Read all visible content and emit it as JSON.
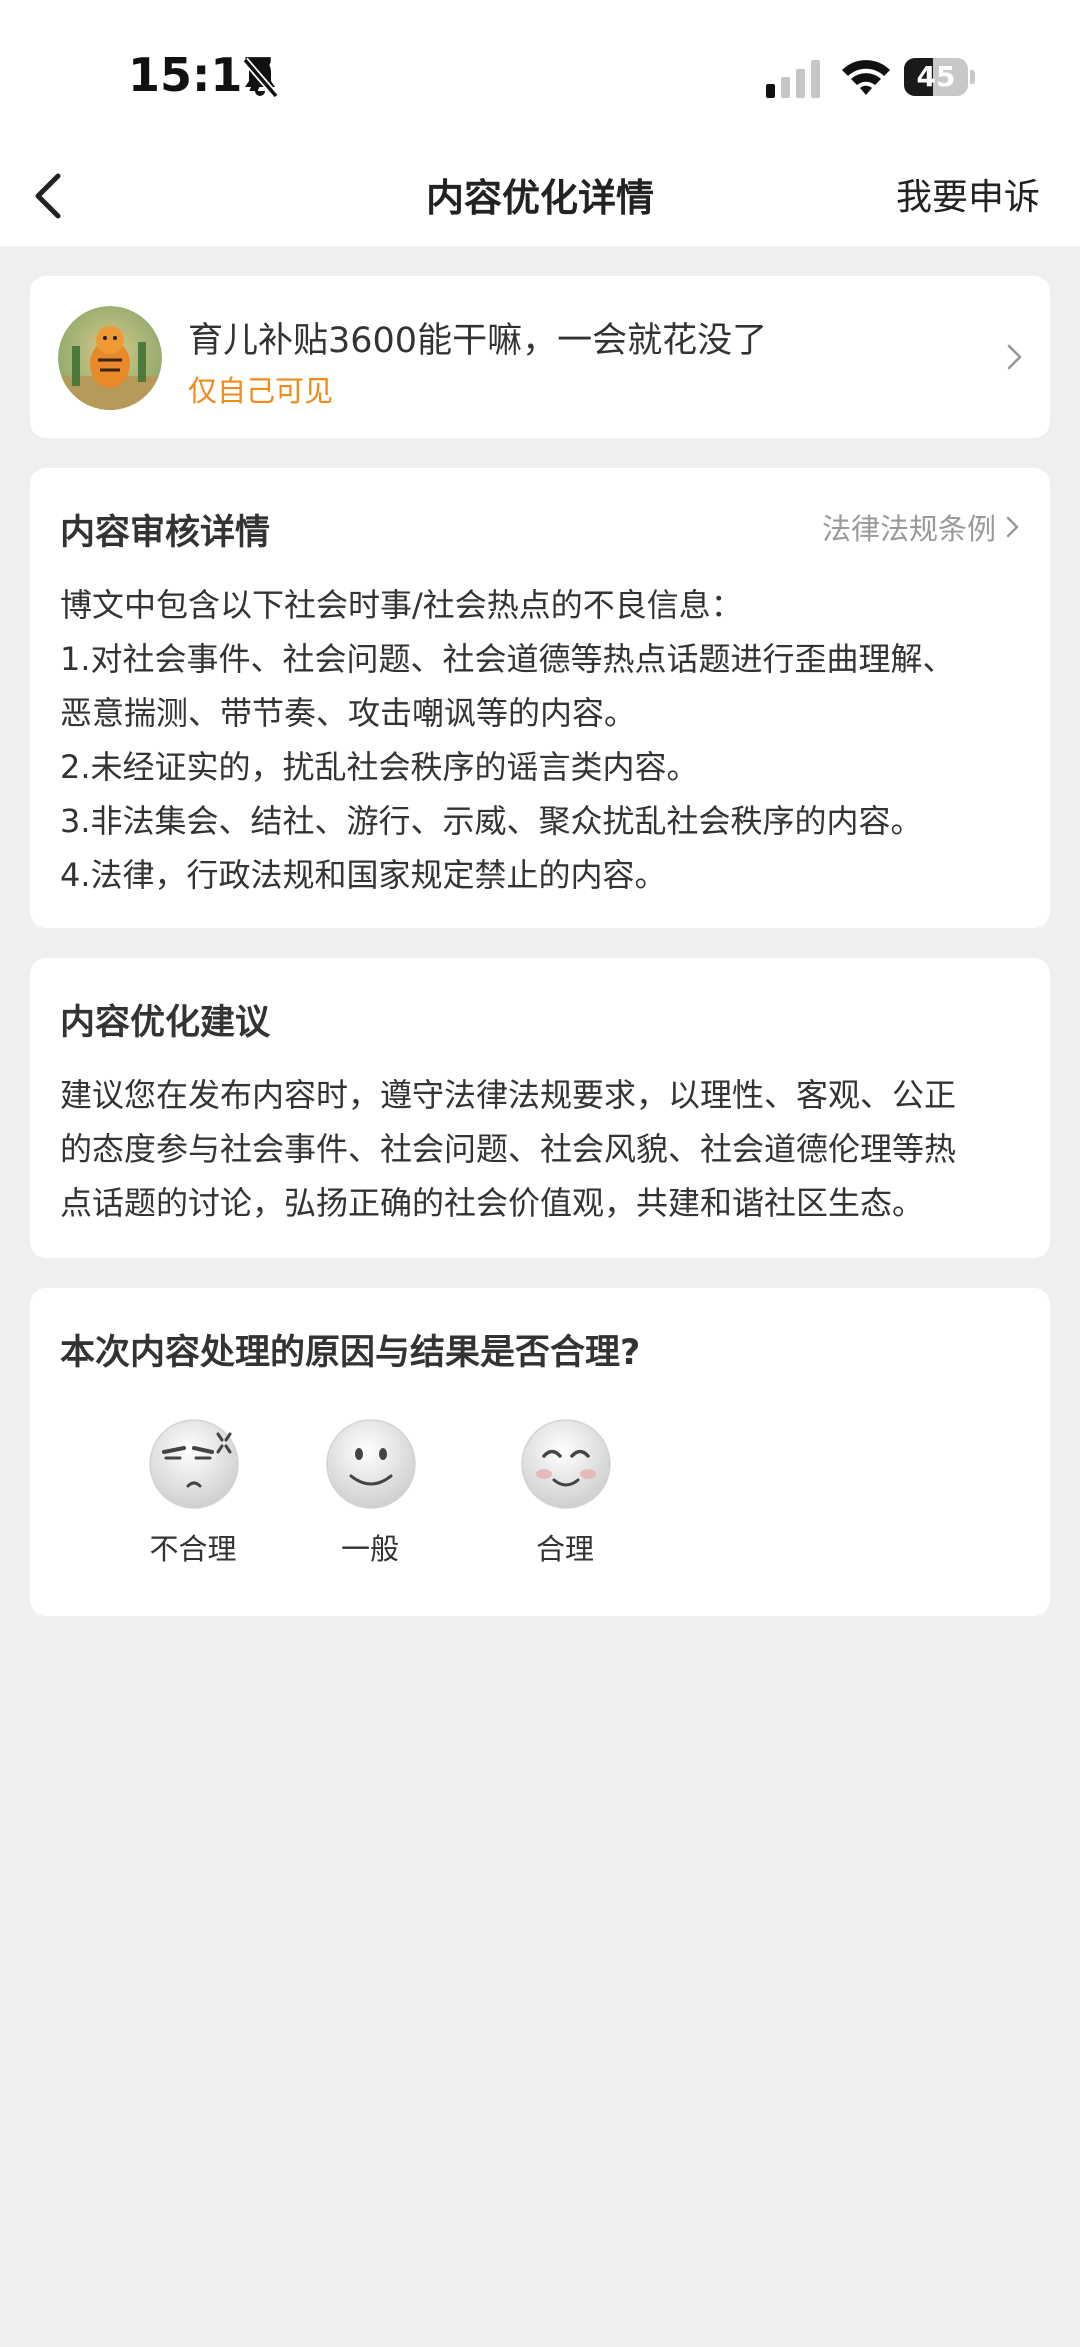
{
  "status_bar": {
    "time": "15:17",
    "battery_level": "45",
    "battery_fraction": 0.45,
    "icons": [
      "bell-slash-icon",
      "cellular-signal-icon",
      "wifi-icon",
      "battery-icon"
    ]
  },
  "nav": {
    "back_icon": "chevron-left-icon",
    "title": "内容优化详情",
    "appeal_label": "我要申诉"
  },
  "post": {
    "title": "育儿补贴3600能干嘛，一会就花没了",
    "visibility": "仅自己可见",
    "visibility_color": "#f08b19"
  },
  "review": {
    "title": "内容审核详情",
    "law_link": "法律法规条例",
    "lines": [
      "博文中包含以下社会时事/社会热点的不良信息：",
      "1.对社会事件、社会问题、社会道德等热点话题进行歪曲理解、",
      "恶意揣测、带节奏、攻击嘲讽等的内容。",
      "2.未经证实的，扰乱社会秩序的谣言类内容。",
      "3.非法集会、结社、游行、示威、聚众扰乱社会秩序的内容。",
      "4.法律，行政法规和国家规定禁止的内容。"
    ]
  },
  "suggestion": {
    "title": "内容优化建议",
    "lines": [
      "建议您在发布内容时，遵守法律法规要求，以理性、客观、公正",
      "的态度参与社会事件、社会问题、社会风貌、社会道德伦理等热",
      "点话题的讨论，弘扬正确的社会价值观，共建和谐社区生态。"
    ]
  },
  "rating": {
    "question": "本次内容处理的原因与结果是否合理?",
    "options": [
      {
        "label": "不合理",
        "icon": "angry-face-icon"
      },
      {
        "label": "一般",
        "icon": "neutral-face-icon"
      },
      {
        "label": "合理",
        "icon": "happy-face-icon"
      }
    ]
  }
}
